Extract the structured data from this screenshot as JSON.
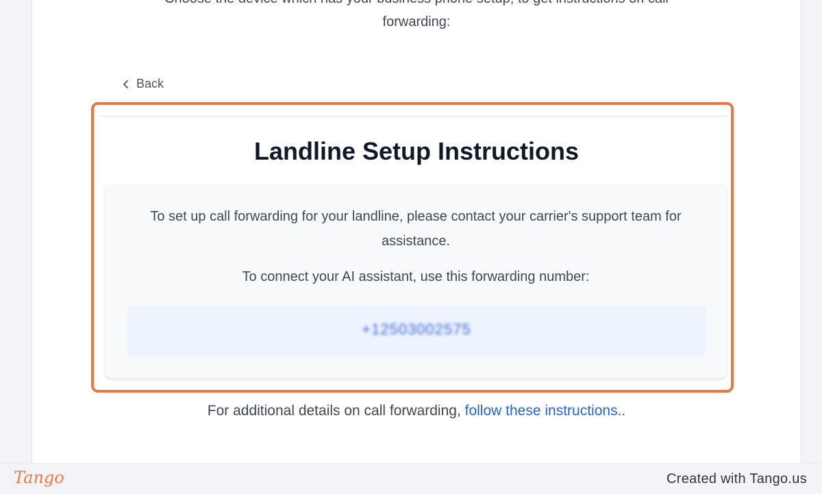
{
  "intro": {
    "line1": "Choose the device which has your business phone setup, to get instructions on call",
    "line2": "forwarding:"
  },
  "back": {
    "label": "Back",
    "icon": "chevron-left-icon"
  },
  "instructions": {
    "title": "Landline Setup Instructions",
    "paragraph1": "To set up call forwarding for your landline, please contact your carrier's support team for assistance.",
    "paragraph2": "To connect your AI assistant, use this forwarding number:",
    "forwarding_number": "+12503002575"
  },
  "footer": {
    "text": "For additional details on call forwarding, ",
    "link_label": "follow these instructions.."
  },
  "watermark": {
    "logo": "Tango",
    "credit": "Created with Tango.us"
  },
  "colors": {
    "highlight": "#f0763f",
    "link": "#2563d9",
    "number": "#2a52c9"
  }
}
